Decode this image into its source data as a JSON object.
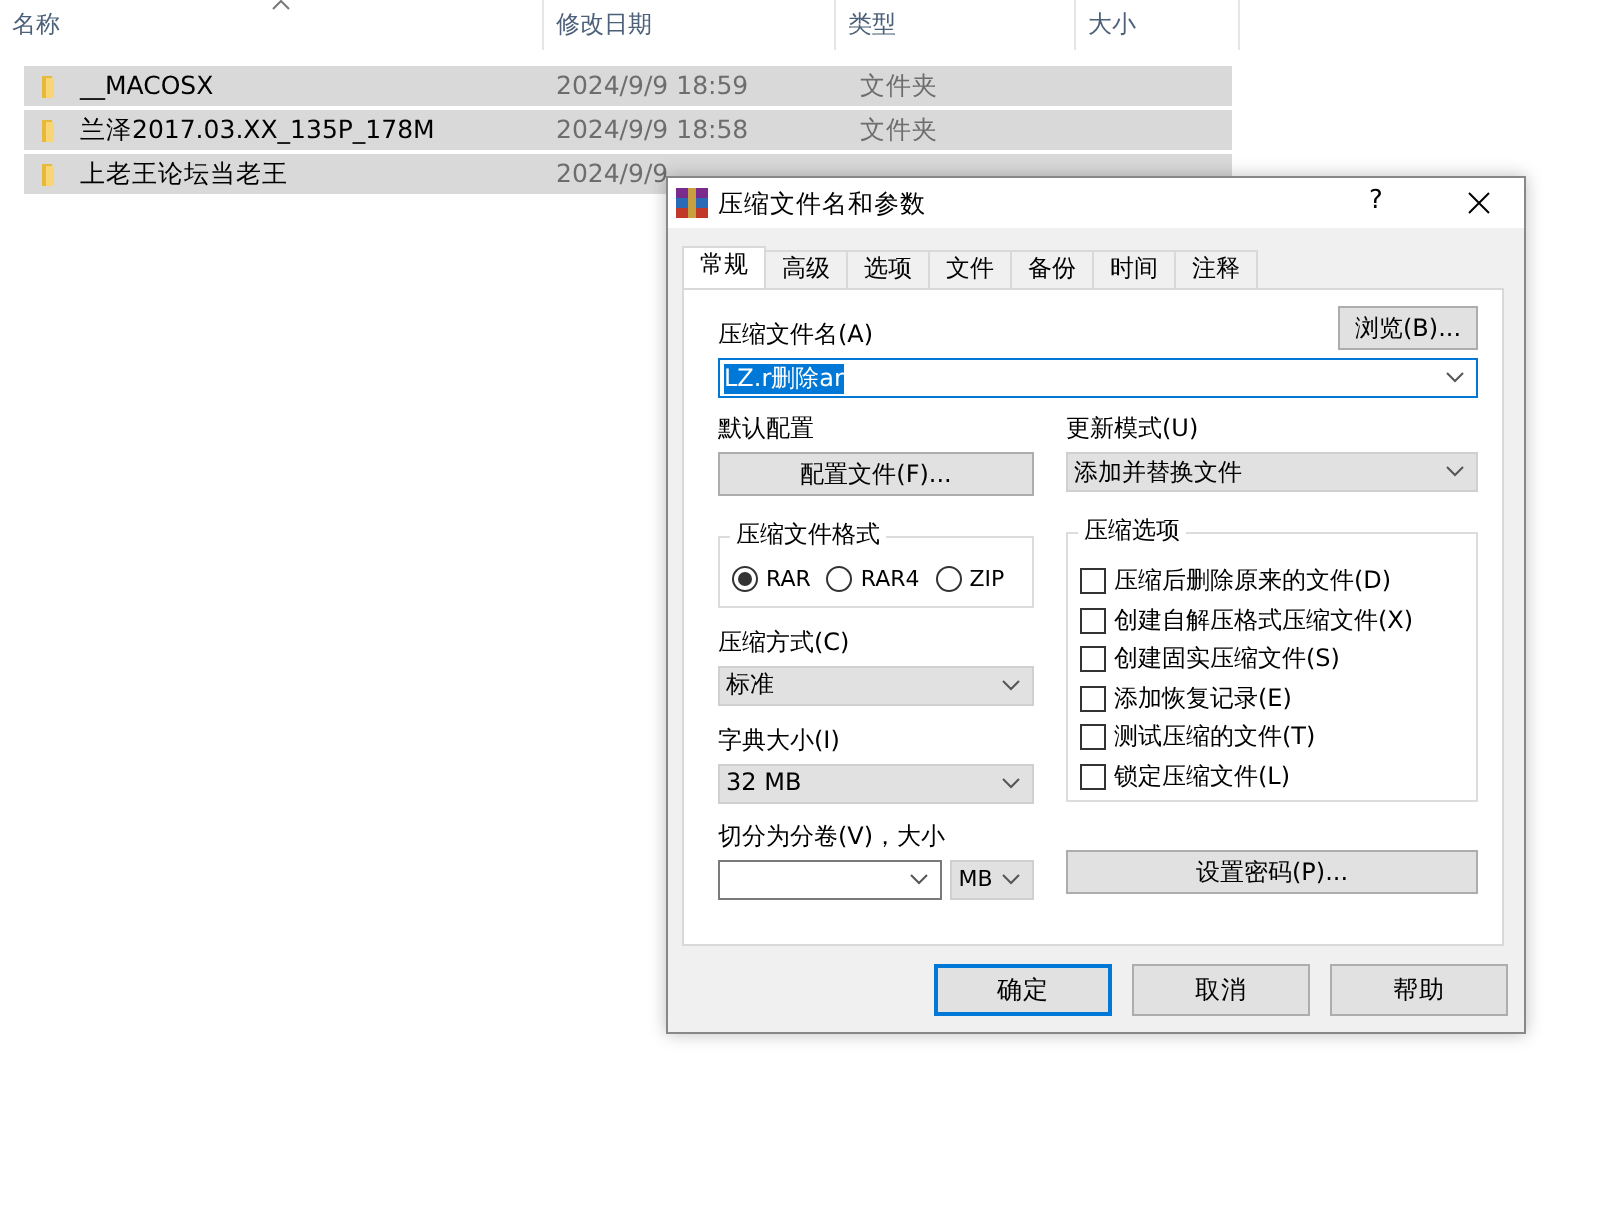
{
  "file_list": {
    "columns": [
      {
        "label": "名称",
        "sorted": true
      },
      {
        "label": "修改日期",
        "sorted": false
      },
      {
        "label": "类型",
        "sorted": false
      },
      {
        "label": "大小",
        "sorted": false
      }
    ],
    "rows": [
      {
        "name": "__MACOSX",
        "modified": "2024/9/9 18:59",
        "type": "文件夹",
        "selected": true
      },
      {
        "name": "兰泽2017.03.XX_135P_178M",
        "modified": "2024/9/9 18:58",
        "type": "文件夹",
        "selected": true
      },
      {
        "name": "上老王论坛当老王",
        "modified": "2024/9/9",
        "selected": true
      }
    ]
  },
  "dialog": {
    "title": "压缩文件名和参数",
    "help_button": "?",
    "tabs": [
      {
        "label": "常规",
        "selected": true
      },
      {
        "label": "高级",
        "selected": false
      },
      {
        "label": "选项",
        "selected": false
      },
      {
        "label": "文件",
        "selected": false
      },
      {
        "label": "备份",
        "selected": false
      },
      {
        "label": "时间",
        "selected": false
      },
      {
        "label": "注释",
        "selected": false
      }
    ],
    "archive_name": {
      "label": "压缩文件名(A)",
      "value": "LZ.r删除ar",
      "text_selected": true
    },
    "browse_button": "浏览(B)...",
    "profile": {
      "label": "默认配置",
      "button": "配置文件(F)..."
    },
    "update_mode": {
      "label": "更新模式(U)",
      "value": "添加并替换文件"
    },
    "format": {
      "label": "压缩文件格式",
      "options": [
        {
          "label": "RAR",
          "selected": true
        },
        {
          "label": "RAR4",
          "selected": false
        },
        {
          "label": "ZIP",
          "selected": false
        }
      ]
    },
    "method": {
      "label": "压缩方式(C)",
      "value": "标准"
    },
    "dictionary": {
      "label": "字典大小(I)",
      "value": "32 MB"
    },
    "split": {
      "label": "切分为分卷(V)，大小",
      "unit": "MB"
    },
    "options": {
      "label": "压缩选项",
      "items": [
        {
          "label": "压缩后删除原来的文件(D)",
          "checked": false
        },
        {
          "label": "创建自解压格式压缩文件(X)",
          "checked": false
        },
        {
          "label": "创建固实压缩文件(S)",
          "checked": false
        },
        {
          "label": "添加恢复记录(E)",
          "checked": false
        },
        {
          "label": "测试压缩的文件(T)",
          "checked": false
        },
        {
          "label": "锁定压缩文件(L)",
          "checked": false
        }
      ]
    },
    "password_button": "设置密码(P)...",
    "buttons": [
      {
        "label": "确定",
        "default": true
      },
      {
        "label": "取消",
        "default": false
      },
      {
        "label": "帮助",
        "default": false
      }
    ]
  }
}
